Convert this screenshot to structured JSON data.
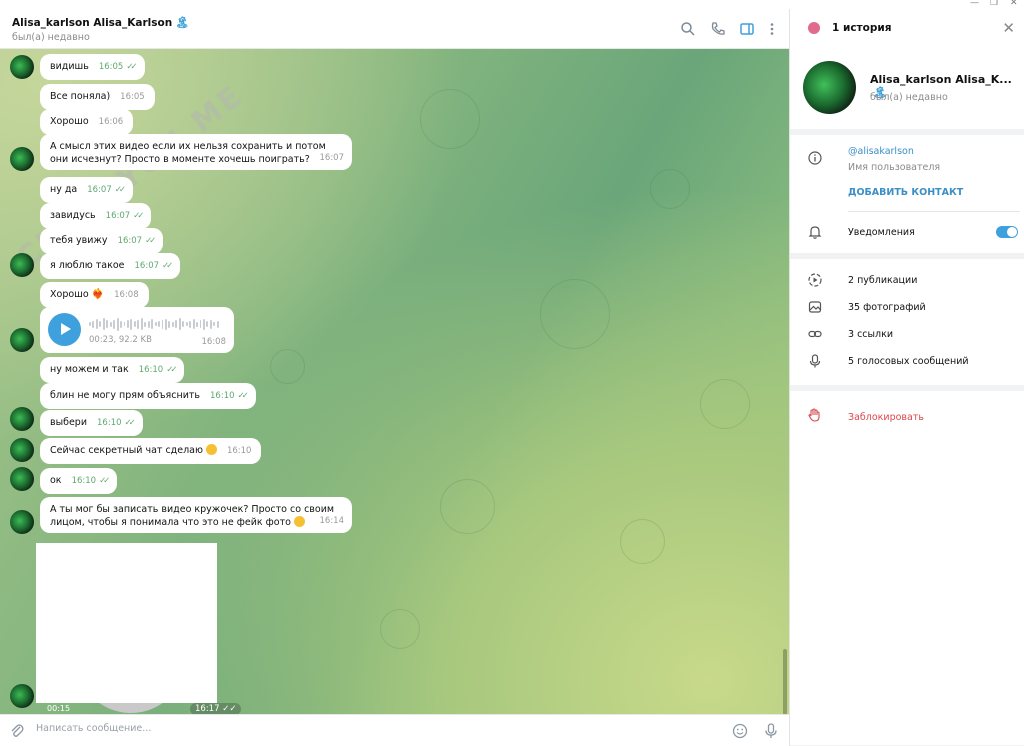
{
  "chat": {
    "title": "Alisa_karlson Alisa_Karlson",
    "title_icon": "🏝",
    "status": "был(а) недавно",
    "watermark": "CHECKYOU.ME",
    "input_placeholder": "Написать сообщение..."
  },
  "messages": [
    {
      "text": "видишь",
      "time": "16:05",
      "read": true
    },
    {
      "text": "Все поняла)",
      "time": "16:05",
      "read": false
    },
    {
      "text": "Хорошо",
      "time": "16:06",
      "read": false
    },
    {
      "text": "А смысл этих видео если их нельзя сохранить и потом они исчезнут? Просто в моменте хочешь поиграть?",
      "time": "16:07",
      "read": false
    },
    {
      "text": "ну да",
      "time": "16:07",
      "read": true
    },
    {
      "text": "завидусь",
      "time": "16:07",
      "read": true
    },
    {
      "text": "тебя увижу",
      "time": "16:07",
      "read": true
    },
    {
      "text": "я люблю такое",
      "time": "16:07",
      "read": true
    },
    {
      "text": "Хорошо",
      "time": "16:08",
      "read": false,
      "emoji": "❤️‍🔥"
    },
    {
      "text": "ну можем и так",
      "time": "16:10",
      "read": true
    },
    {
      "text": "блин не могу прям объяснить",
      "time": "16:10",
      "read": true
    },
    {
      "text": "выбери",
      "time": "16:10",
      "read": true
    },
    {
      "text": "Сейчас секретный чат сделаю",
      "time": "16:10",
      "read": false,
      "emoji": "😅"
    },
    {
      "text": "ок",
      "time": "16:10",
      "read": true
    },
    {
      "text": "А ты мог бы записать видео кружочек? Просто со своим лицом, чтобы я понимала что это не фейк фото",
      "time": "16:14",
      "read": false,
      "emoji": "😏"
    }
  ],
  "voice": {
    "duration": "00:23",
    "size": "92.2 KB",
    "meta": "00:23, 92.2 KB",
    "time": "16:08"
  },
  "video_note": {
    "duration": "00:15",
    "time": "16:17"
  },
  "panel": {
    "stories": "1 история",
    "name": "Alisa_karlson Alisa_K...",
    "status": "был(а) недавно",
    "username": "@alisakarlson",
    "username_caption": "Имя пользователя",
    "add_contact": "ДОБАВИТЬ КОНТАКТ",
    "notifications": "Уведомления",
    "notifications_on": true,
    "media": [
      "2 публикации",
      "35 фотографий",
      "3 ссылки",
      "5 голосовых сообщений"
    ],
    "block": "Заблокировать"
  },
  "colors": {
    "accent": "#3ea0dd",
    "read_check": "#5fa870",
    "danger": "#d9494e"
  }
}
